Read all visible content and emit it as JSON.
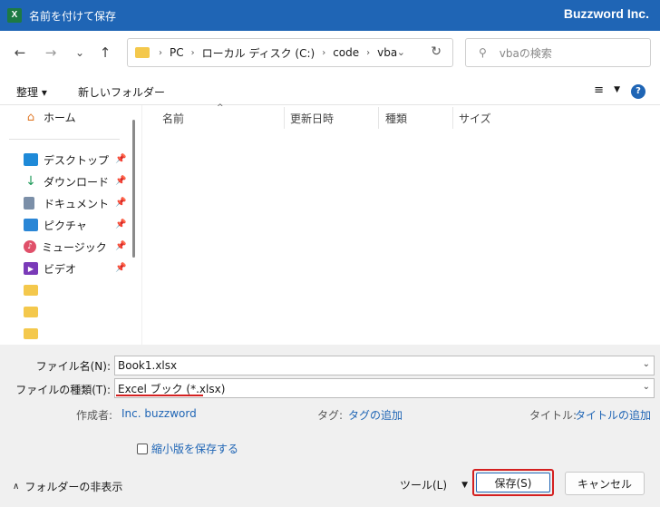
{
  "window": {
    "title": "名前を付けて保存",
    "app_icon_letter": "X",
    "brand": "Buzzword Inc."
  },
  "navigation": {
    "back_icon": "←",
    "forward_icon": "→",
    "recent_icon": "⌄",
    "up_icon": "↑",
    "breadcrumb": [
      "PC",
      "ローカル ディスク (C:)",
      "code",
      "vba"
    ],
    "search_placeholder": "vbaの検索"
  },
  "toolbar": {
    "organize": "整理 ▾",
    "new_folder": "新しいフォルダー",
    "help": "?"
  },
  "sidebar": {
    "items": [
      {
        "label": "ホーム",
        "icon": "home-icon",
        "pinned": false
      },
      {
        "label": "デスクトップ",
        "icon": "desktop-icon",
        "pinned": true
      },
      {
        "label": "ダウンロード",
        "icon": "download-icon",
        "pinned": true
      },
      {
        "label": "ドキュメント",
        "icon": "document-icon",
        "pinned": true
      },
      {
        "label": "ピクチャ",
        "icon": "picture-icon",
        "pinned": true
      },
      {
        "label": "ミュージック",
        "icon": "music-icon",
        "pinned": true
      },
      {
        "label": "ビデオ",
        "icon": "video-icon",
        "pinned": true
      }
    ]
  },
  "file_list": {
    "columns": [
      "名前",
      "更新日時",
      "種類",
      "サイズ"
    ]
  },
  "form": {
    "filename_label": "ファイル名(N):",
    "filename_value": "Book1.xlsx",
    "filetype_label": "ファイルの種類(T):",
    "filetype_value": "Excel ブック (*.xlsx)",
    "author_label": "作成者:",
    "author_value": "Inc. buzzword",
    "tags_label": "タグ:",
    "tags_value": "タグの追加",
    "title_label": "タイトル:",
    "title_value": "タイトルの追加",
    "thumbnail_label": "縮小版を保存する"
  },
  "footer": {
    "hide_folders": "フォルダーの非表示",
    "tools": "ツール(L)",
    "save": "保存(S)",
    "cancel": "キャンセル"
  },
  "colors": {
    "accent": "#1f65b5",
    "highlight": "#d42020",
    "excel_green": "#1d7a43"
  }
}
